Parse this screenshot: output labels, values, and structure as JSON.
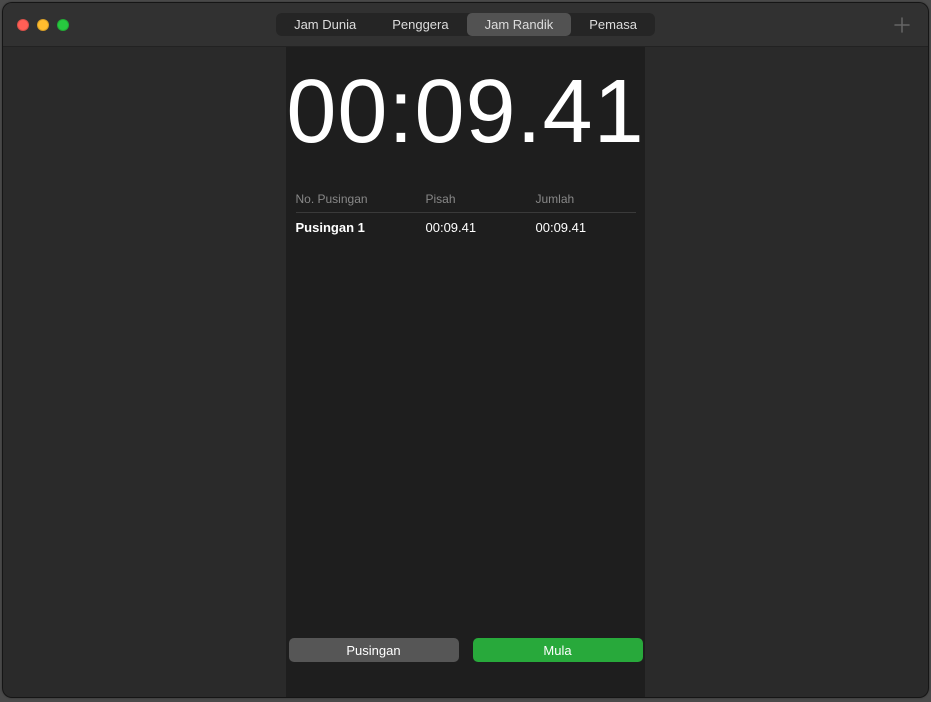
{
  "tabs": [
    {
      "label": "Jam Dunia",
      "active": false
    },
    {
      "label": "Penggera",
      "active": false
    },
    {
      "label": "Jam Randik",
      "active": true
    },
    {
      "label": "Pemasa",
      "active": false
    }
  ],
  "stopwatch": {
    "time": "00:09.41",
    "table": {
      "headers": {
        "lap": "No. Pusingan",
        "split": "Pisah",
        "total": "Jumlah"
      },
      "rows": [
        {
          "lap": "Pusingan 1",
          "split": "00:09.41",
          "total": "00:09.41"
        }
      ]
    }
  },
  "buttons": {
    "lap": "Pusingan",
    "start": "Mula"
  }
}
